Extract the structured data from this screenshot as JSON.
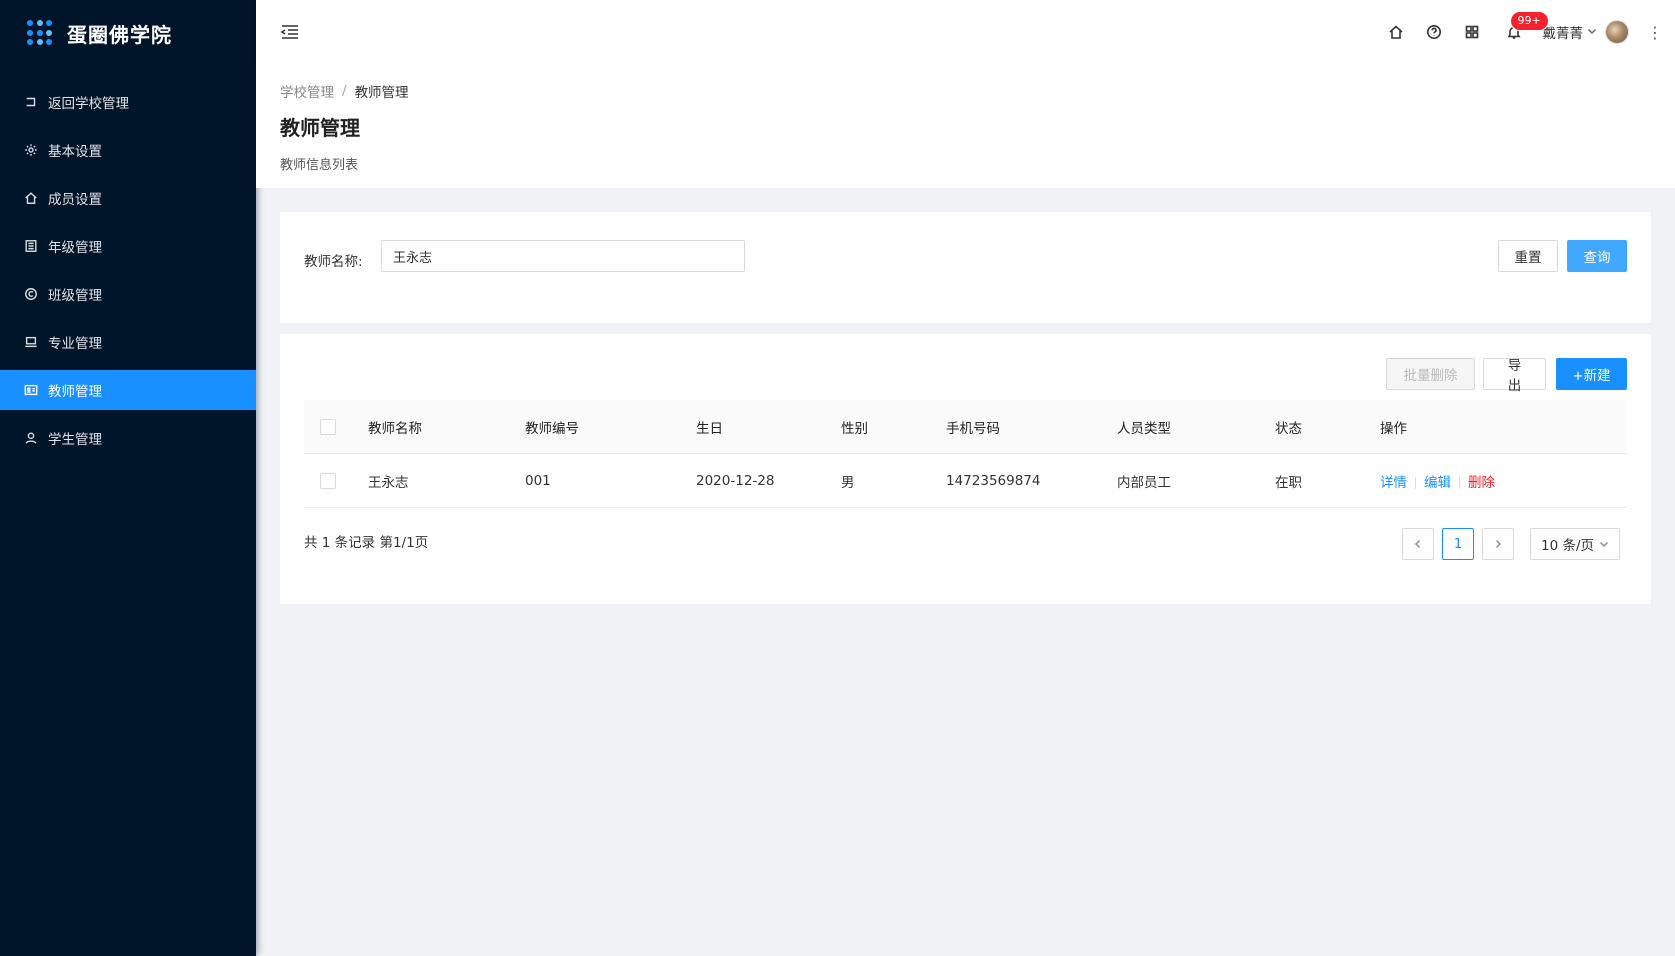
{
  "app": {
    "title": "蛋圈佛学院"
  },
  "sidebar": {
    "items": [
      {
        "label": "返回学校管理",
        "icon": "return-icon"
      },
      {
        "label": "基本设置",
        "icon": "gear-icon"
      },
      {
        "label": "成员设置",
        "icon": "home-icon"
      },
      {
        "label": "年级管理",
        "icon": "list-icon"
      },
      {
        "label": "班级管理",
        "icon": "copyright-icon"
      },
      {
        "label": "专业管理",
        "icon": "laptop-icon"
      },
      {
        "label": "教师管理",
        "icon": "idcard-icon",
        "active": true
      },
      {
        "label": "学生管理",
        "icon": "user-icon"
      }
    ]
  },
  "header": {
    "notification_count": "99+",
    "user_name": "戴菁菁",
    "more_label": "⋮"
  },
  "page": {
    "breadcrumb": {
      "parent": "学校管理",
      "separator": "/",
      "current": "教师管理"
    },
    "title": "教师管理",
    "description": "教师信息列表"
  },
  "search": {
    "label": "教师名称:",
    "value": "王永志",
    "reset_label": "重置",
    "query_label": "查询"
  },
  "toolbar": {
    "batch_delete_label": "批量删除",
    "export_label": "导 出",
    "new_label": "+新建"
  },
  "table": {
    "columns": [
      "教师名称",
      "教师编号",
      "生日",
      "性别",
      "手机号码",
      "人员类型",
      "状态",
      "操作"
    ],
    "rows": [
      {
        "name": "王永志",
        "code": "001",
        "birthday": "2020-12-28",
        "gender": "男",
        "phone": "14723569874",
        "type": "内部员工",
        "status": "在职",
        "ops": {
          "detail": "详情",
          "edit": "编辑",
          "delete": "删除"
        }
      }
    ]
  },
  "pagination": {
    "summary": "共 1 条记录 第1/1页",
    "current_page": "1",
    "page_size": "10 条/页"
  },
  "colors": {
    "sidebar_bg": "#001529",
    "primary": "#1890ff",
    "danger": "#f5222d"
  }
}
